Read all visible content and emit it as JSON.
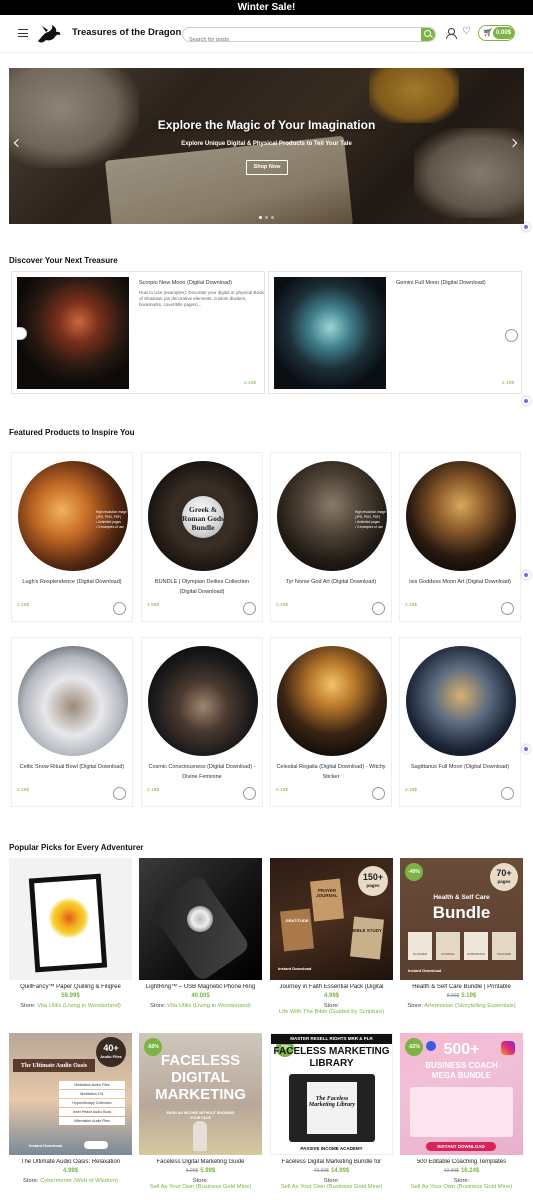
{
  "announcement": "Winter Sale!",
  "header": {
    "site_title": "Treasures of the Dragon",
    "search_placeholder": "Search for posts",
    "cart_total": "0.00$"
  },
  "hero": {
    "title": "Explore the Magic of Your Imagination",
    "subtitle": "Explore Unique Digital & Physical Products to Tell Your Tale",
    "button": "Shop Now"
  },
  "sections": {
    "discover": "Discover Your Next Treasure",
    "featured": "Featured Products to Inspire You",
    "popular": "Popular Picks for Every Adventurer"
  },
  "treasures": [
    {
      "name": "Scorpio New Moon (Digital Download)",
      "desc": "How to Use (examples): Decorate your digital or physical Book of Shadows (as decorative elements, custom dividers, bookmarks, coverttitle pages)...",
      "price": "2.19$"
    },
    {
      "name": "Gemini Full Moon (Digital Download)",
      "desc": "",
      "price": "2.19$"
    }
  ],
  "featured": [
    {
      "title": "Lugh's Resplendence (Digital Download)",
      "price": "2.19$"
    },
    {
      "title": "BUNDLE | Olympian Deities Collection (Digital Download)",
      "price": "4.99$",
      "badge": "Greek & Roman Gods Bundle"
    },
    {
      "title": "Tyr Norse God Art (Digital Download)",
      "price": "2.19$"
    },
    {
      "title": "Isis Goddess Moon Art (Digital Download)",
      "price": "2.19$"
    },
    {
      "title": "Celtic Snow Ritual Bowl (Digital Download)",
      "price": "2.19$"
    },
    {
      "title": "Cosmic Consciousness (Digital Download) - Divine Feminine",
      "price": "2.19$"
    },
    {
      "title": "Celestial Regalia (Digital Download) - Witchy Sticker",
      "price": "2.19$"
    },
    {
      "title": "Sagittarius Full Moon (Digital Download)",
      "price": "2.19$"
    }
  ],
  "popular": [
    {
      "title": "QuillFancy™ Paper Quilling & Filigree",
      "price": "59.99$",
      "old": "",
      "store_label": "Store:",
      "vendor": "Vita Utilis (Living in Wonderland)",
      "badge": ""
    },
    {
      "title": "LightRing™ – USB Magnetic Phone Ring",
      "price": "40.00$",
      "old": "",
      "store_label": "Store:",
      "vendor": "Vita Utilis (Living in Wonderland)",
      "badge": ""
    },
    {
      "title": "Journey in Faith Essential Pack (Digital",
      "price": "4.99$",
      "old": "",
      "store_label": "Store:",
      "vendor": "Life With The Bible (Guided by Scripture)",
      "badge": ""
    },
    {
      "title": "Health & Self Care Bundle | Printable",
      "price": "5.19$",
      "old": "8.99$",
      "store_label": "Store:",
      "vendor": "Artemesian (Storytelling Essentials)",
      "badge": "-40%"
    },
    {
      "title": "The Ultimate Audio Oasis: Relaxation",
      "price": "4.99$",
      "old": "",
      "store_label": "Store:",
      "vendor": "Cybermente (Web of Wisdom)",
      "badge": ""
    },
    {
      "title": "Faceless Digital Marketing Guide",
      "price": "5.99$",
      "old": "8.99$",
      "store_label": "Store:",
      "vendor": "Sell As Your Own (Business Gold Mine)",
      "badge": "-60%"
    },
    {
      "title": "Faceless Digital Marketing Bundle for",
      "price": "14.99$",
      "old": "49.99$",
      "store_label": "Store:",
      "vendor": "Sell As Your Own (Business Gold Mine)",
      "badge": "-70%"
    },
    {
      "title": "500 Editable Coaching Templates",
      "price": "16.24$",
      "old": "42.99$",
      "store_label": "Store:",
      "vendor": "Sell As Your Own (Business Gold Mine)",
      "badge": "-62%"
    }
  ],
  "image_text": {
    "lugh_small": "High resolution image (JPG, PNG, PDF)",
    "lugh_small2": "• Unlimited pages",
    "lugh_small3": "• 3 examples of use",
    "tyr_small": "High resolution image (JPG, PNG, PDF)",
    "tyr_small2": "• Unlimited pages",
    "tyr_small3": "• 3 examples of use",
    "faith_count": "150+",
    "faith_sub": "pages",
    "faith_a": "PRAYER JOURNAL",
    "faith_b": "GRATITUDE",
    "faith_c": "BIBLE STUDY",
    "faith_dl": "Instant Download",
    "health_count": "70+",
    "health_sub": "pages",
    "health_t1": "Health & Self Care",
    "health_t2": "Bundle",
    "health_p": [
      "PLANNER",
      "JOURNAL",
      "WORKBOOK",
      "TRACKER"
    ],
    "health_dl": "Instant Download",
    "audio_count": "40+",
    "audio_sub": "Audio Files",
    "audio_title": "The Ultimate Audio Oasis",
    "audio_list": [
      "Meditation Audio Files",
      "Meditation 101",
      "Hypnotherapy Collection",
      "Inner Peace Audio Book",
      "Affirmation Audio Files"
    ],
    "audio_dl": "Instant Download",
    "faceless_t1": "FACELESS",
    "faceless_t2": "DIGITAL",
    "faceless_t3": "MARKETING",
    "faceless_sub": "EARN AN INCOME WITHOUT SHOWING YOUR FACE",
    "fml_top": "MASTER RESELL RIGHTS MRR & PLR",
    "fml_t1": "FACELESS MARKETING",
    "fml_t2": "LIBRARY",
    "fml_book": "The Faceless Marketing Library",
    "fml_bottom": "PASSIVE INCOME ACADEMY",
    "coach_t1": "500+",
    "coach_t2": "BUSINESS COACH",
    "coach_t3": "MEGA BUNDLE",
    "coach_dl": "INSTANT DOWNLOAD"
  }
}
